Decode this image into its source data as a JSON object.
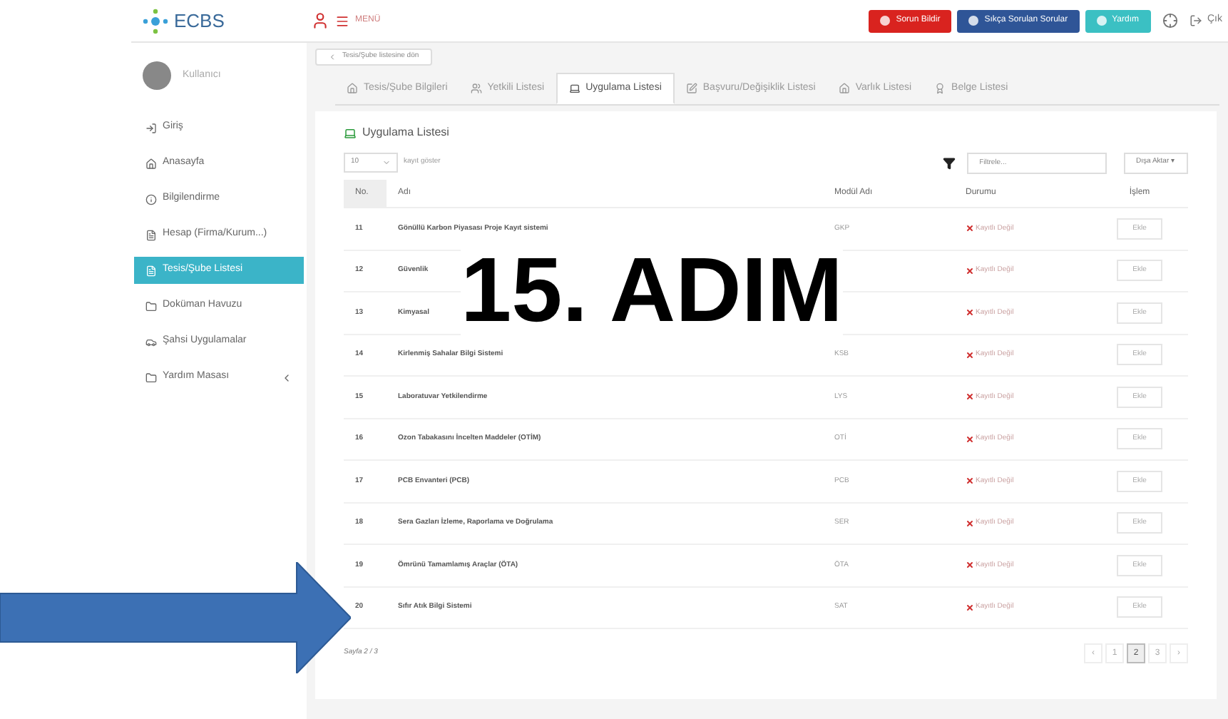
{
  "topbar": {
    "logo": "ECBS",
    "menu": "MENÜ",
    "buttons": [
      {
        "label": "Sorun Bildir",
        "kind": "danger"
      },
      {
        "label": "Sıkça Sorulan Sorular",
        "kind": "primary"
      },
      {
        "label": "Yardım",
        "kind": "info"
      }
    ],
    "logout": "Çık"
  },
  "user": {
    "name": "Kullanıcı"
  },
  "sidebar": {
    "items": [
      {
        "label": "Giriş",
        "selected": false,
        "expandable": false
      },
      {
        "label": "Anasayfa",
        "selected": false,
        "expandable": false
      },
      {
        "label": "Bilgilendirme",
        "selected": false,
        "expandable": false
      },
      {
        "label": "Hesap (Firma/Kurum...)",
        "selected": false,
        "expandable": false
      },
      {
        "label": "Tesis/Şube Listesi",
        "selected": true,
        "expandable": false
      },
      {
        "label": "Doküman Havuzu",
        "selected": false,
        "expandable": false
      },
      {
        "label": "Şahsi Uygulamalar",
        "selected": false,
        "expandable": false
      },
      {
        "label": "Yardım Masası",
        "selected": false,
        "expandable": true
      }
    ]
  },
  "back_button": "Tesis/Şube listesine dön",
  "tabs": [
    {
      "label": "Tesis/Şube Bilgileri",
      "selected": false
    },
    {
      "label": "Yetkili Listesi",
      "selected": false
    },
    {
      "label": "Uygulama Listesi",
      "selected": true
    },
    {
      "label": "Başvuru/Değişiklik Listesi",
      "selected": false
    },
    {
      "label": "Varlık Listesi",
      "selected": false
    },
    {
      "label": "Belge Listesi",
      "selected": false
    }
  ],
  "panel": {
    "title": "Uygulama Listesi",
    "page_size": "10",
    "page_size_label": "kayıt göster",
    "filter": {
      "placeholder": "Filtrele..."
    },
    "export": "Dışa Aktar ▾"
  },
  "table": {
    "columns": [
      "No.",
      "Adı",
      "Modül Adı",
      "Durumu",
      "İşlem"
    ],
    "rows": [
      {
        "no": "11",
        "name": "Gönüllü Karbon Piyasası Proje Kayıt sistemi",
        "module": "GKP",
        "status": "Kayıtlı Değil",
        "action": "Ekle"
      },
      {
        "no": "12",
        "name": "Güvenlik",
        "status": "Kayıtlı Değil",
        "action": "Ekle"
      },
      {
        "no": "13",
        "name": "Kimyasal",
        "status": "Kayıtlı Değil",
        "action": "Ekle"
      },
      {
        "no": "14",
        "name": "Kirlenmiş Sahalar Bilgi Sistemi",
        "module": "KSB",
        "status": "Kayıtlı Değil",
        "action": "Ekle"
      },
      {
        "no": "15",
        "name": "Laboratuvar Yetkilendirme",
        "module": "LYS",
        "status": "Kayıtlı Değil",
        "action": "Ekle"
      },
      {
        "no": "16",
        "name": "Ozon Tabakasını İncelten Maddeler (OTİM)",
        "module": "OTİ",
        "status": "Kayıtlı Değil",
        "action": "Ekle"
      },
      {
        "no": "17",
        "name": "PCB Envanteri (PCB)",
        "module": "PCB",
        "status": "Kayıtlı Değil",
        "action": "Ekle"
      },
      {
        "no": "18",
        "name": "Sera Gazları İzleme, Raporlama ve Doğrulama",
        "module": "SER",
        "status": "Kayıtlı Değil",
        "action": "Ekle"
      },
      {
        "no": "19",
        "name": "Ömrünü Tamamlamış Araçlar (ÖTA)",
        "module": "ÖTA",
        "status": "Kayıtlı Değil",
        "action": "Ekle"
      },
      {
        "no": "20",
        "name": "Sıfır Atık Bilgi Sistemi",
        "module": "SAT",
        "status": "Kayıtlı Değil",
        "action": "Ekle"
      }
    ]
  },
  "footer": {
    "page_info": "Sayfa 2 / 3",
    "pages": [
      {
        "label": "‹",
        "selected": false
      },
      {
        "label": "1",
        "selected": false
      },
      {
        "label": "2",
        "selected": true
      },
      {
        "label": "3",
        "selected": false
      },
      {
        "label": "›",
        "selected": false
      }
    ]
  },
  "overlay": {
    "step": "15. ADIM"
  }
}
